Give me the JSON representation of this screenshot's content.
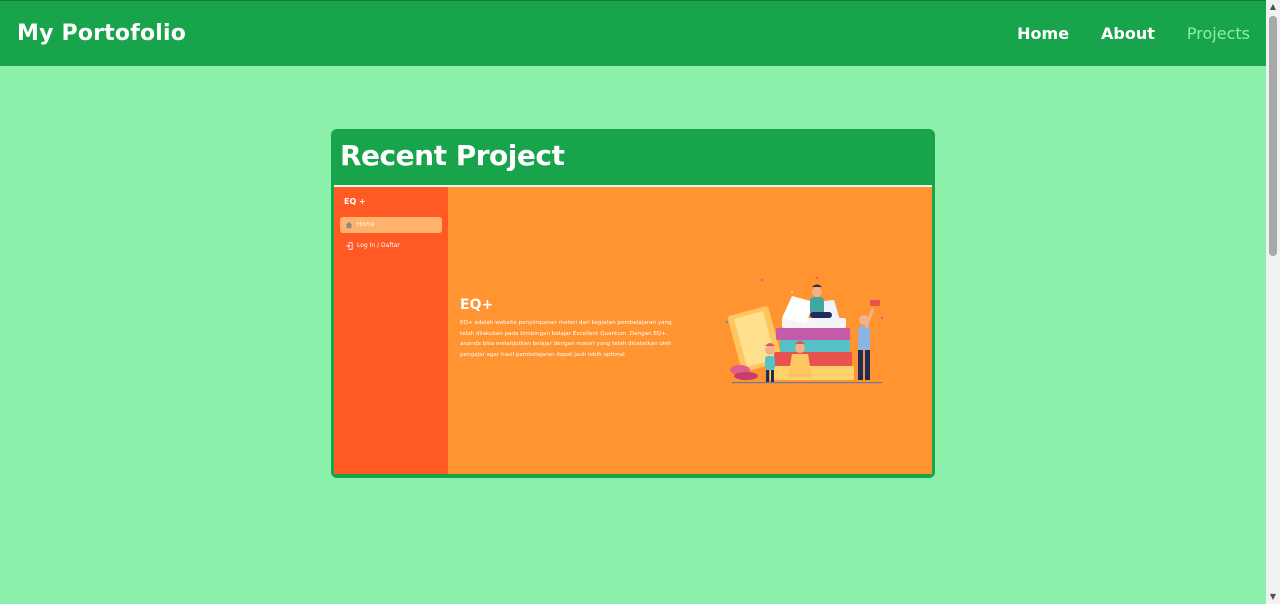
{
  "navbar": {
    "brand": "My Portofolio",
    "links": [
      {
        "label": "Home",
        "active": false
      },
      {
        "label": "About",
        "active": false
      },
      {
        "label": "Projects",
        "active": true
      }
    ]
  },
  "card": {
    "title": "Recent Project",
    "preview": {
      "sidebar": {
        "brand": "EQ +",
        "items": [
          {
            "label": "Home",
            "icon": "home-icon",
            "active": true
          },
          {
            "label": "Log In / Daftar",
            "icon": "login-icon",
            "active": false
          }
        ]
      },
      "heading": "EQ+",
      "description": "EQ+ adalah website penyimpanan materi dari kegiatan pembelajaran yang telah dilakukan pada bimbingan belajar Excellent Quantum. Dengan EQ+, ananda bisa melanjutkan belajar dengan materi yang telah dicatatkan oleh pengajar agar hasil pembelajaran dapat jauh lebih optimal."
    }
  },
  "colors": {
    "background": "#8af0aa",
    "navbar": "#18a44a",
    "active_link": "#8af0aa",
    "preview_main": "#ff9431",
    "preview_sidebar": "#ff5a24"
  }
}
